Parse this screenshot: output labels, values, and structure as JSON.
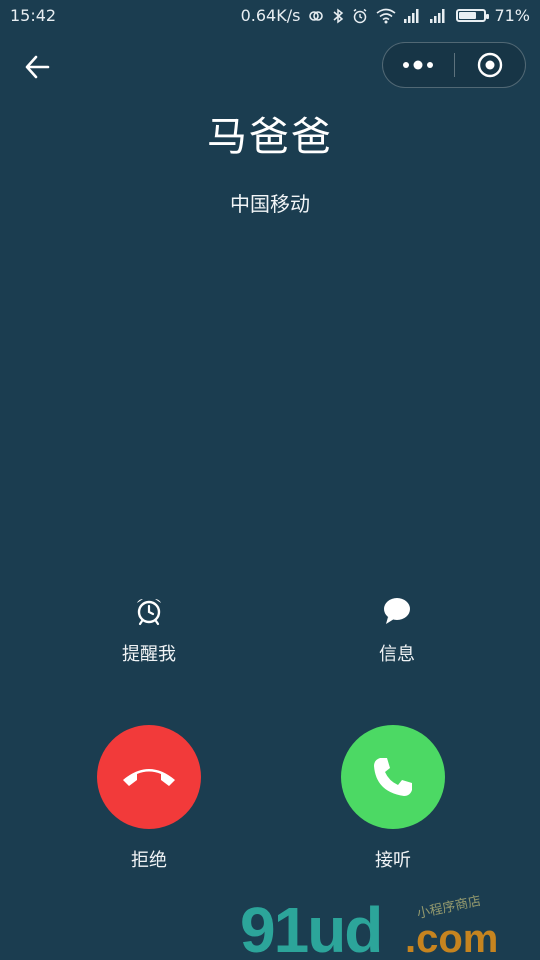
{
  "status_bar": {
    "time": "15:42",
    "network_speed": "0.64K/s",
    "battery_percent": "71%",
    "battery_level": 0.71,
    "icons": [
      "link-icon",
      "bluetooth-icon",
      "alarm-icon",
      "wifi-icon",
      "signal-icon",
      "signal-icon",
      "battery-icon"
    ]
  },
  "call": {
    "caller_name": "马爸爸",
    "carrier": "中国移动"
  },
  "actions": {
    "remind_label": "提醒我",
    "message_label": "信息",
    "decline_label": "拒绝",
    "accept_label": "接听"
  },
  "colors": {
    "background": "#1b3d50",
    "decline": "#f23a3a",
    "accept": "#4cd964"
  },
  "watermark": {
    "text": "91ud.com",
    "subtext": "小程序商店"
  }
}
